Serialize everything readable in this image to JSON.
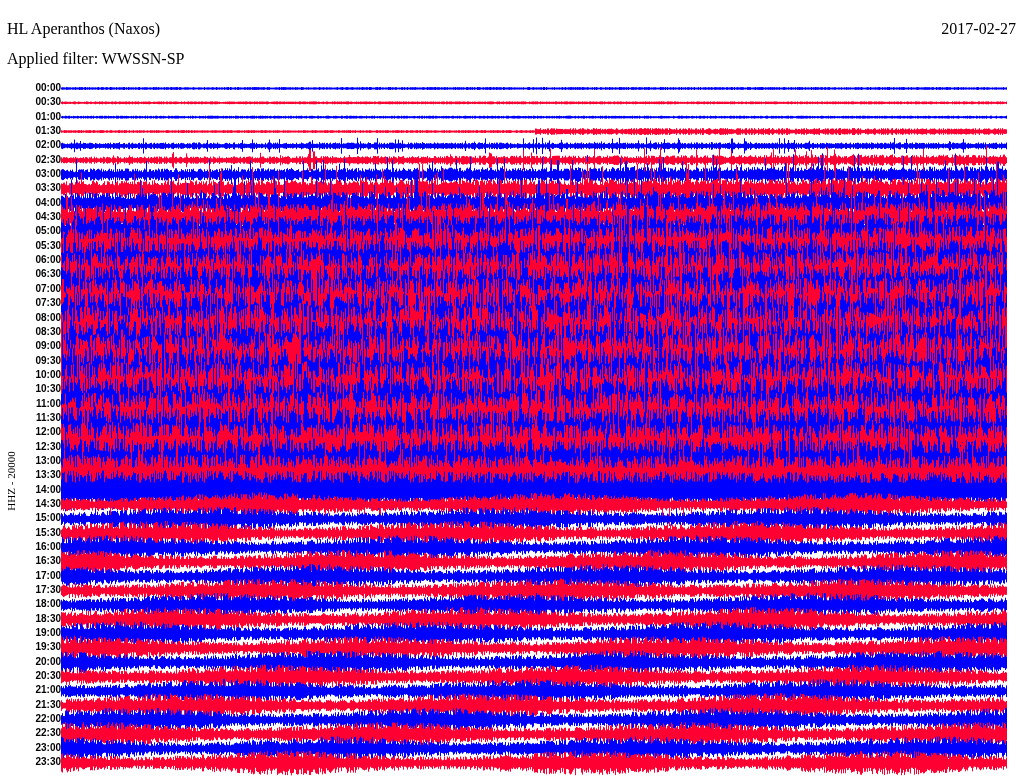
{
  "station_title": "HL Aperanthos (Naxos)",
  "date": "2017-02-27",
  "filter_text": "Applied filter: WWSSN-SP",
  "channel_label": "HHZ - 20000",
  "time_labels": [
    "00:00",
    "00:30",
    "01:00",
    "01:30",
    "02:00",
    "02:30",
    "03:00",
    "03:30",
    "04:00",
    "04:30",
    "05:00",
    "05:30",
    "06:00",
    "06:30",
    "07:00",
    "07:30",
    "08:00",
    "08:30",
    "09:00",
    "09:30",
    "10:00",
    "10:30",
    "11:00",
    "11:30",
    "12:00",
    "12:30",
    "13:00",
    "13:30",
    "14:00",
    "14:30",
    "15:00",
    "15:30",
    "16:00",
    "16:30",
    "17:00",
    "17:30",
    "18:00",
    "18:30",
    "19:00",
    "19:30",
    "20:00",
    "20:30",
    "21:00",
    "21:30",
    "22:00",
    "22:30",
    "23:00",
    "23:30"
  ]
}
